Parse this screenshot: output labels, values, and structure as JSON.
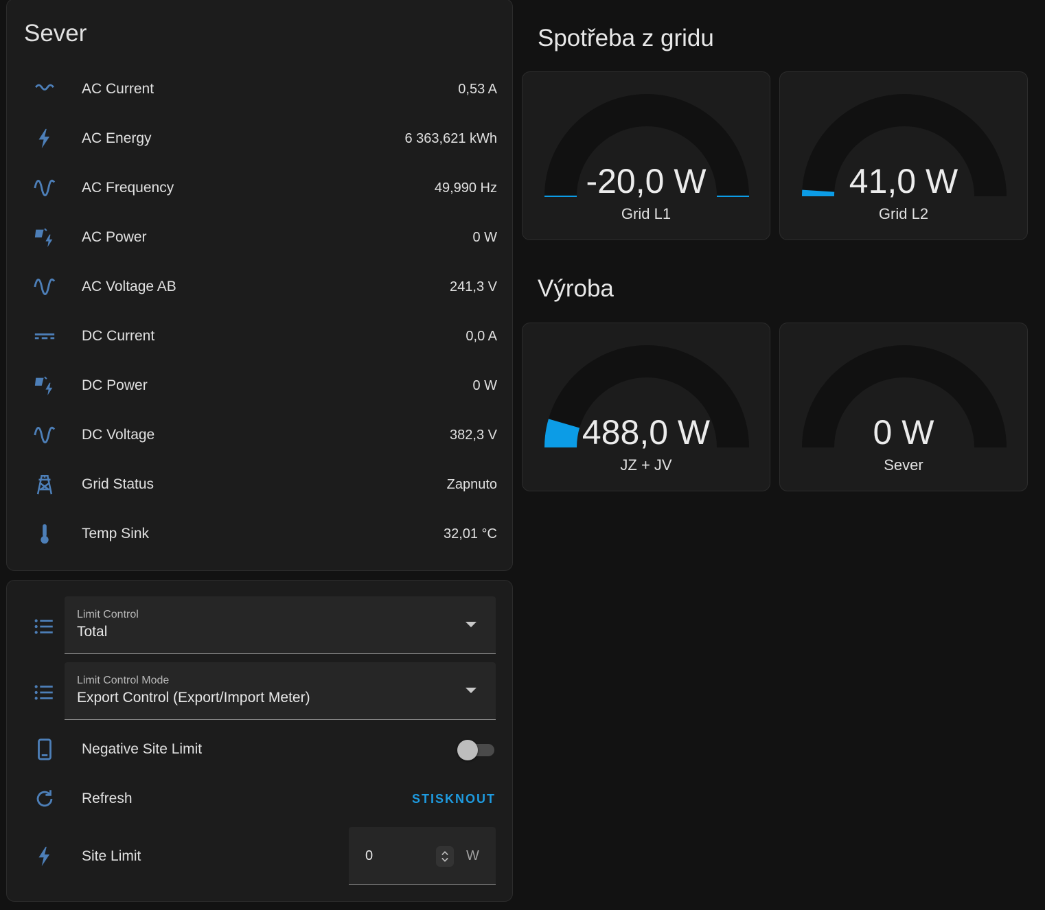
{
  "entities_card": {
    "title": "Sever",
    "rows": [
      {
        "icon": "sine-wave-current-icon",
        "name": "AC Current",
        "value": "0,53 A"
      },
      {
        "icon": "lightning-bolt-icon",
        "name": "AC Energy",
        "value": "6 363,621 kWh"
      },
      {
        "icon": "sine-wave-icon",
        "name": "AC Frequency",
        "value": "49,990 Hz"
      },
      {
        "icon": "solar-power-icon",
        "name": "AC Power",
        "value": "0 W"
      },
      {
        "icon": "sine-wave-icon",
        "name": "AC Voltage AB",
        "value": "241,3 V"
      },
      {
        "icon": "current-dc-icon",
        "name": "DC Current",
        "value": "0,0 A"
      },
      {
        "icon": "solar-power-icon",
        "name": "DC Power",
        "value": "0 W"
      },
      {
        "icon": "sine-wave-icon",
        "name": "DC Voltage",
        "value": "382,3 V"
      },
      {
        "icon": "transmission-tower-icon",
        "name": "Grid Status",
        "value": "Zapnuto"
      },
      {
        "icon": "thermometer-icon",
        "name": "Temp Sink",
        "value": "32,01 °C"
      }
    ]
  },
  "controls_card": {
    "limit_control": {
      "icon": "format-list-bulleted-icon",
      "label": "Limit Control",
      "value": "Total"
    },
    "limit_control_mode": {
      "icon": "format-list-bulleted-icon",
      "label": "Limit Control Mode",
      "value": "Export Control (Export/Import Meter)"
    },
    "negative_site_limit": {
      "icon": "tablet-icon",
      "name": "Negative Site Limit",
      "on": false
    },
    "refresh": {
      "icon": "refresh-icon",
      "name": "Refresh",
      "button_label": "STISKNOUT"
    },
    "site_limit": {
      "icon": "lightning-bolt-icon",
      "name": "Site Limit",
      "value": "0",
      "unit": "W"
    }
  },
  "grid_section": {
    "title": "Spotřeba z gridu",
    "gauges": [
      {
        "value_text": "-20,0 W",
        "name": "Grid L1",
        "fraction": -0.01
      },
      {
        "value_text": "41,0 W",
        "name": "Grid L2",
        "fraction": 0.02
      }
    ]
  },
  "production_section": {
    "title": "Výroba",
    "gauges": [
      {
        "value_text": "488,0 W",
        "name": "JZ + JV",
        "fraction": 0.09
      },
      {
        "value_text": "0 W",
        "name": "Sever",
        "fraction": 0
      }
    ]
  },
  "colors": {
    "accent": "#1e9be0",
    "icon": "#4d7fb8",
    "gauge_fill": "#0c9ce6",
    "gauge_track": "#111111"
  }
}
